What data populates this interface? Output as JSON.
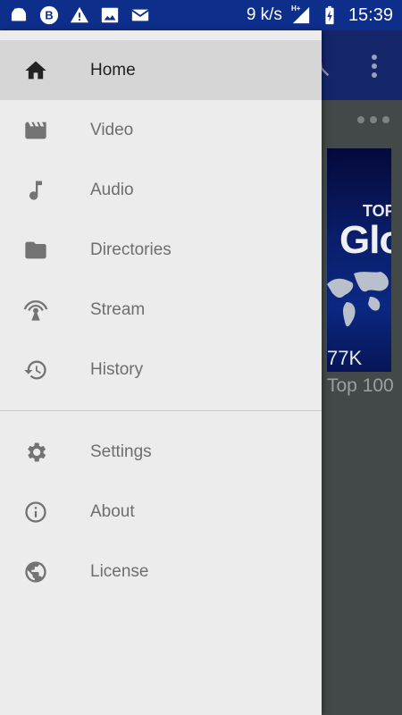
{
  "status_bar": {
    "network_speed": "9 k/s",
    "network_type": "H+",
    "time": "15:39",
    "icons": [
      "android-icon",
      "b-badge-icon",
      "warning-icon",
      "image-icon",
      "mail-icon",
      "signal-icon",
      "battery-charging-icon"
    ]
  },
  "background": {
    "thumbnail_top_text": "TOP",
    "thumbnail_title_text": "Glo",
    "thumbnail_count": "77K",
    "caption": "Top 100"
  },
  "drawer": {
    "primary_items": [
      {
        "label": "Home",
        "icon": "home-icon",
        "active": true
      },
      {
        "label": "Video",
        "icon": "video-icon",
        "active": false
      },
      {
        "label": "Audio",
        "icon": "music-note-icon",
        "active": false
      },
      {
        "label": "Directories",
        "icon": "folder-icon",
        "active": false
      },
      {
        "label": "Stream",
        "icon": "stream-antenna-icon",
        "active": false
      },
      {
        "label": "History",
        "icon": "history-icon",
        "active": false
      }
    ],
    "secondary_items": [
      {
        "label": "Settings",
        "icon": "gear-icon"
      },
      {
        "label": "About",
        "icon": "info-icon"
      },
      {
        "label": "License",
        "icon": "globe-icon"
      }
    ]
  },
  "colors": {
    "status_bar": "#0e2e8c",
    "toolbar": "#15256a",
    "drawer_bg": "#ececec",
    "active_item_bg": "#d6d6d6",
    "scrim": "#434948"
  }
}
